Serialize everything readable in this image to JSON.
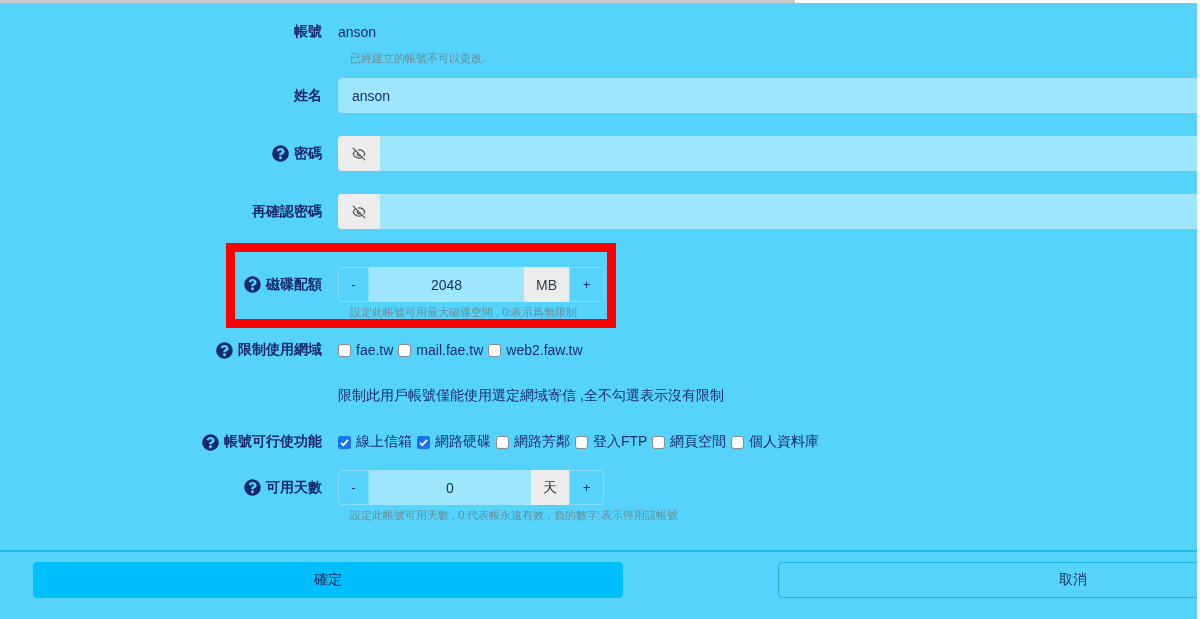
{
  "form": {
    "fields": [
      {
        "kind": "text",
        "label": "帳號",
        "help": false,
        "value": "anson",
        "hint": "已經建立的帳號不可以更改."
      },
      {
        "kind": "input",
        "label": "姓名",
        "help": false,
        "value": "anson"
      },
      {
        "kind": "password",
        "label": "密碼",
        "help": true
      },
      {
        "kind": "password",
        "label": "再確認密碼",
        "help": false
      },
      {
        "kind": "stepper",
        "label": "磁碟配額",
        "help": true,
        "decrement": "-",
        "value": "2048",
        "unit": "MB",
        "increment": "+",
        "hint": "設定此帳號可用最大磁碟空間 , 0:表示爲無限制",
        "highlighted": true
      },
      {
        "kind": "checkboxes",
        "label": "限制使用網域",
        "help": true,
        "options": [
          {
            "label": "fae.tw",
            "checked": false
          },
          {
            "label": "mail.fae.tw",
            "checked": false
          },
          {
            "label": "web2.faw.tw",
            "checked": false
          }
        ],
        "note": "限制此用戶帳號僅能使用選定網域寄信 ,全不勾選表示沒有限制"
      },
      {
        "kind": "checkboxes",
        "label": "帳號可行使功能",
        "help": true,
        "options": [
          {
            "label": "線上信箱",
            "checked": true
          },
          {
            "label": "網路硬碟",
            "checked": true
          },
          {
            "label": "網路芳鄰",
            "checked": false
          },
          {
            "label": "登入FTP",
            "checked": false
          },
          {
            "label": "網頁空間",
            "checked": false
          },
          {
            "label": "個人資料庫",
            "checked": false
          }
        ]
      },
      {
        "kind": "stepper",
        "label": "可用天數",
        "help": true,
        "decrement": "-",
        "value": "0",
        "unit": "天",
        "increment": "+",
        "hint": "設定此帳號可用天數 , 0:代表帳永遠有效 , 負的數字:表示停用該帳號",
        "highlighted": false
      }
    ]
  },
  "buttons": [
    {
      "label": "確定",
      "primary": true
    },
    {
      "label": "取消",
      "primary": false
    }
  ]
}
